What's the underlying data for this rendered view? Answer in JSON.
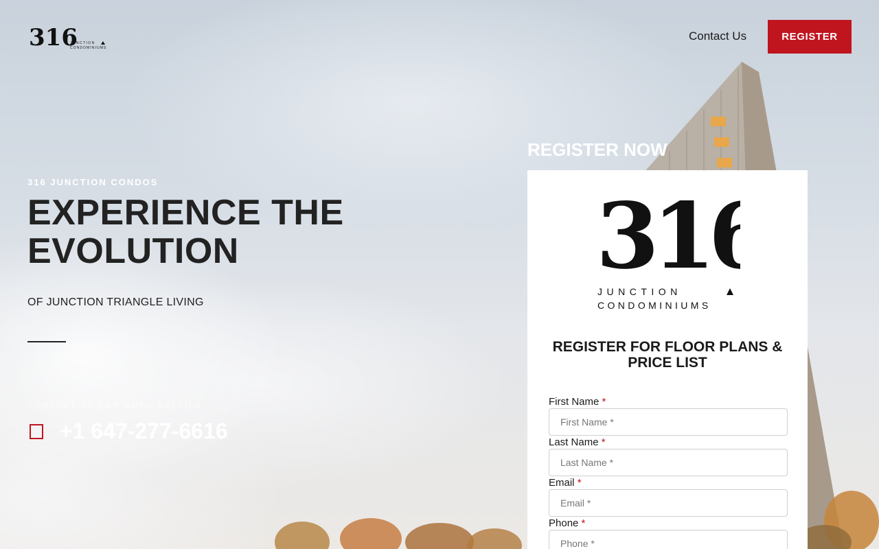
{
  "header": {
    "logo_number": "316",
    "logo_line1": "JUNCTION",
    "logo_line2": "CONDOMINIUMS",
    "contact_label": "Contact Us",
    "register_label": "REGISTER"
  },
  "hero": {
    "eyebrow": "316 JUNCTION CONDOS",
    "headline": "EXPERIENCE THE EVOLUTION",
    "subline": "OF JUNCTION TRIANGLE LIVING",
    "contact_caption": "CONTACT US FOR MORE DETAILS",
    "phone": "+1 647-277-6616"
  },
  "register": {
    "title": "REGISTER NOW",
    "logo_line1": "JUNCTION",
    "logo_line2": "CONDOMINIUMS",
    "form_heading": "REGISTER FOR FLOOR PLANS & PRICE LIST",
    "fields": [
      {
        "label": "First Name",
        "required": "*",
        "placeholder": "First Name *"
      },
      {
        "label": "Last Name",
        "required": "*",
        "placeholder": "Last Name *"
      },
      {
        "label": "Email",
        "required": "*",
        "placeholder": "Email *"
      },
      {
        "label": "Phone",
        "required": "*",
        "placeholder": "Phone *"
      }
    ]
  },
  "colors": {
    "accent": "#c0141f",
    "text_dark": "#222222"
  },
  "icons": {
    "phone": "phone-icon"
  }
}
